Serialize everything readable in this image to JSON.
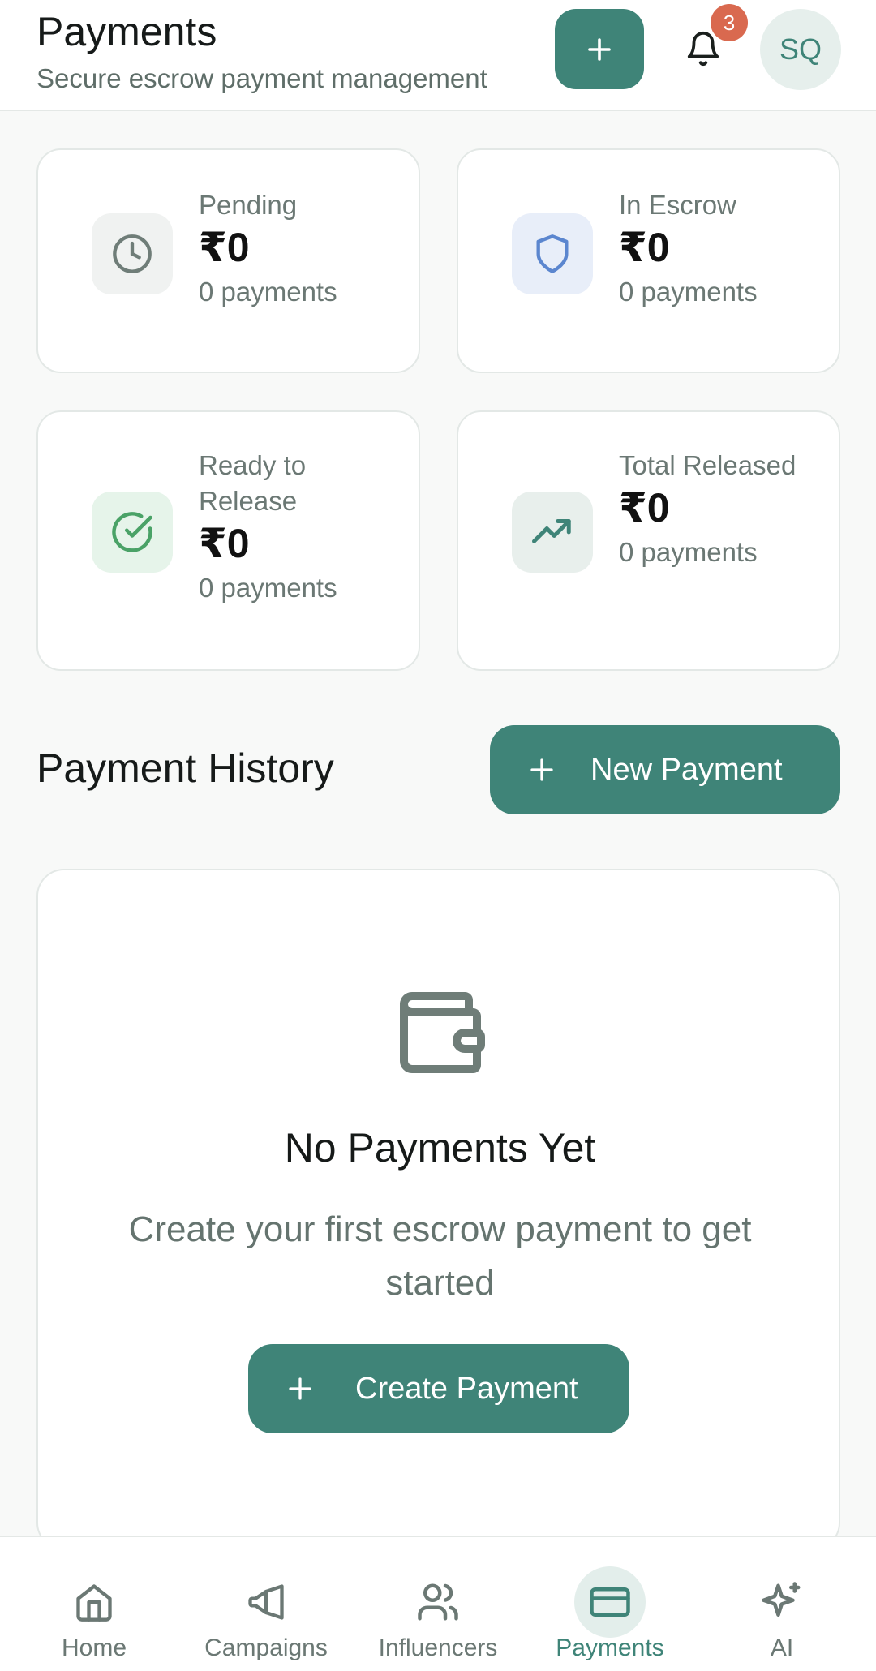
{
  "header": {
    "title": "Payments",
    "subtitle": "Secure escrow payment management",
    "notification_count": "3",
    "avatar_initials": "SQ"
  },
  "stats": [
    {
      "label": "Pending",
      "value": "₹0",
      "count": "0 payments",
      "icon": "clock-icon",
      "icon_bg": "#f0f2f1",
      "icon_color": "#6f7d78"
    },
    {
      "label": "In Escrow",
      "value": "₹0",
      "count": "0 payments",
      "icon": "shield-icon",
      "icon_bg": "#e8eef9",
      "icon_color": "#5b86cf"
    },
    {
      "label": "Ready to Release",
      "value": "₹0",
      "count": "0 payments",
      "icon": "check-circle-icon",
      "icon_bg": "#e6f4ea",
      "icon_color": "#4aa267"
    },
    {
      "label": "Total Released",
      "value": "₹0",
      "count": "0 payments",
      "icon": "trending-up-icon",
      "icon_bg": "#e8efec",
      "icon_color": "#3f8478"
    }
  ],
  "history": {
    "title": "Payment History",
    "new_payment_label": "New Payment"
  },
  "empty_state": {
    "icon": "wallet-icon",
    "title": "No Payments Yet",
    "description": "Create your first escrow payment to get started",
    "button_label": "Create Payment"
  },
  "nav": {
    "items": [
      {
        "label": "Home",
        "icon": "home-icon"
      },
      {
        "label": "Campaigns",
        "icon": "megaphone-icon"
      },
      {
        "label": "Influencers",
        "icon": "users-icon"
      },
      {
        "label": "Payments",
        "icon": "credit-card-icon",
        "active": true
      },
      {
        "label": "AI",
        "icon": "sparkles-icon"
      }
    ]
  },
  "colors": {
    "accent": "#3f8478",
    "badge": "#d9694f",
    "background": "#f8f9f8"
  }
}
